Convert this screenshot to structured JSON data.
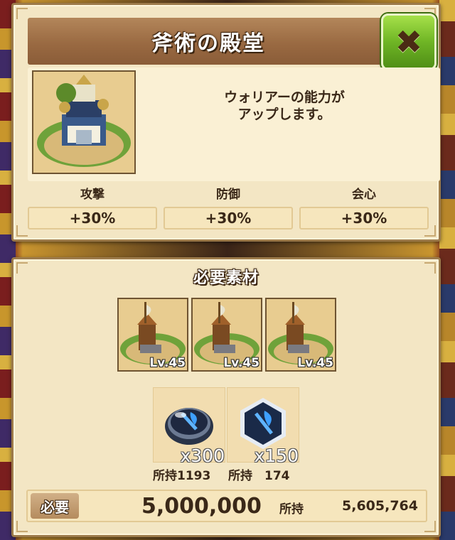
{
  "title": "斧術の殿堂",
  "close_icon": "close-icon",
  "description_line1": "ウォリアーの能力が",
  "description_line2": "アップします。",
  "stats": [
    {
      "label": "攻撃",
      "value": "+30%"
    },
    {
      "label": "防御",
      "value": "+30%"
    },
    {
      "label": "会心",
      "value": "+30%"
    }
  ],
  "materials_title": "必要素材",
  "materials": [
    {
      "level": "Lv.45",
      "icon": "axe-tower-building-icon"
    },
    {
      "level": "Lv.45",
      "icon": "axe-tower-building-icon"
    },
    {
      "level": "Lv.45",
      "icon": "axe-tower-building-icon"
    }
  ],
  "gems": [
    {
      "qty": "x300",
      "owned": "所持1193",
      "icon": "blue-axe-gem-round-icon"
    },
    {
      "qty": "x150",
      "owned": "所持　174",
      "icon": "blue-axe-gem-hex-icon"
    }
  ],
  "cost": {
    "need_label": "必要",
    "need_value": "5,000,000",
    "own_label": "所持",
    "own_value": "5,605,764"
  },
  "colors": {
    "panel_bg": "#f3e6c4",
    "title_bar": "#9a6a42",
    "close_button": "#6fb525",
    "text": "#3a2818"
  }
}
